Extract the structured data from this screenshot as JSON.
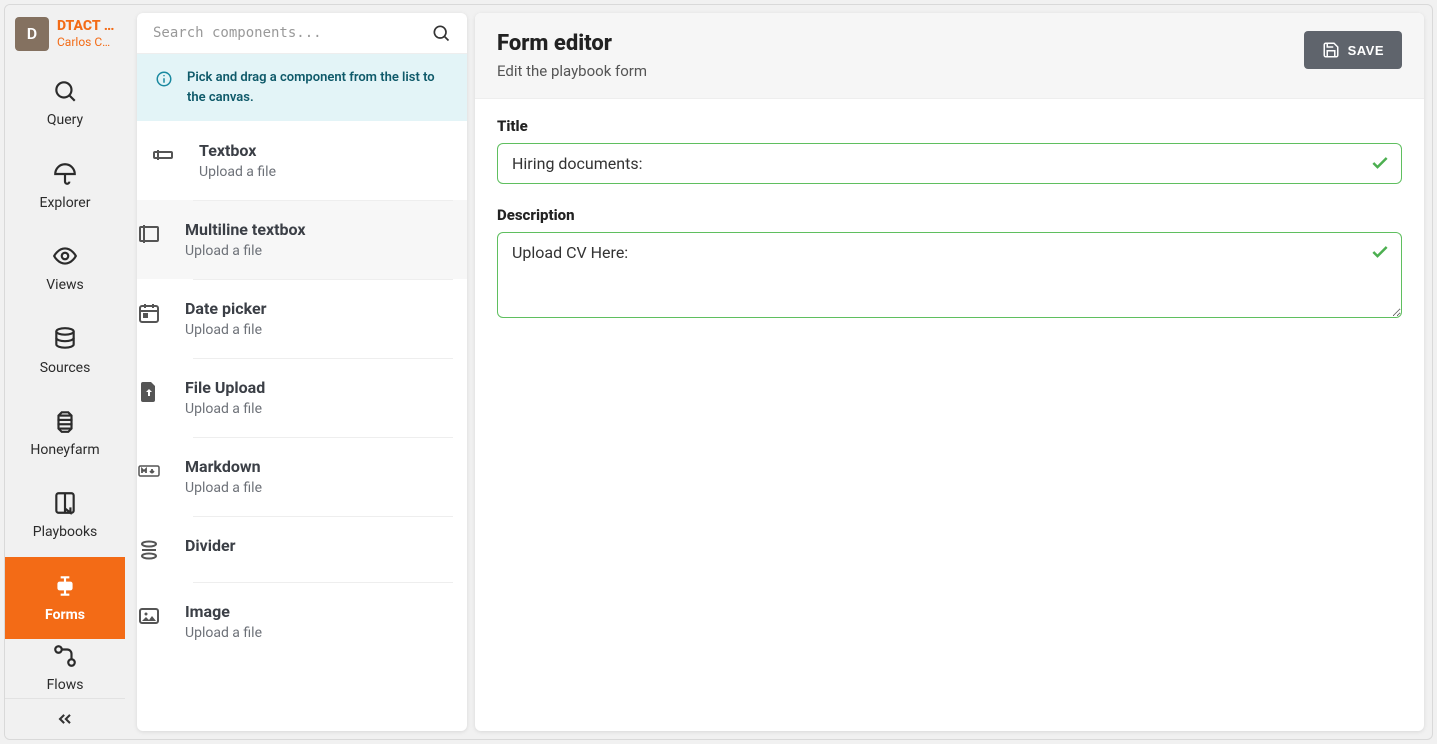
{
  "brand": {
    "avatar_letter": "D",
    "title": "DTACT …",
    "subtitle": "Carlos Ca…"
  },
  "sidebar": {
    "items": [
      {
        "id": "query",
        "label": "Query",
        "icon": "search-icon"
      },
      {
        "id": "explorer",
        "label": "Explorer",
        "icon": "umbrella-icon"
      },
      {
        "id": "views",
        "label": "Views",
        "icon": "eye-icon"
      },
      {
        "id": "sources",
        "label": "Sources",
        "icon": "database-icon"
      },
      {
        "id": "honeyfarm",
        "label": "Honeyfarm",
        "icon": "hive-icon"
      },
      {
        "id": "playbooks",
        "label": "Playbooks",
        "icon": "playbook-icon"
      },
      {
        "id": "forms",
        "label": "Forms",
        "icon": "form-icon",
        "active": true
      },
      {
        "id": "flows",
        "label": "Flows",
        "icon": "flow-icon"
      }
    ]
  },
  "components_panel": {
    "search_placeholder": "Search components...",
    "info_message": "Pick and drag a component from the list to the canvas.",
    "items": [
      {
        "title": "Textbox",
        "sub": "Upload a file",
        "icon": "textbox-icon"
      },
      {
        "title": "Multiline textbox",
        "sub": "Upload a file",
        "icon": "multiline-icon"
      },
      {
        "title": "Date picker",
        "sub": "Upload a file",
        "icon": "calendar-icon"
      },
      {
        "title": "File Upload",
        "sub": "Upload a file",
        "icon": "file-upload-icon"
      },
      {
        "title": "Markdown",
        "sub": "Upload a file",
        "icon": "markdown-icon"
      },
      {
        "title": "Divider",
        "sub": "",
        "icon": "divider-icon"
      },
      {
        "title": "Image",
        "sub": "Upload a file",
        "icon": "image-icon"
      }
    ]
  },
  "editor": {
    "heading": "Form editor",
    "subheading": "Edit the playbook form",
    "save_label": "SAVE",
    "fields": {
      "title_label": "Title",
      "title_value": "Hiring documents:",
      "description_label": "Description",
      "description_value": "Upload CV Here:"
    }
  }
}
